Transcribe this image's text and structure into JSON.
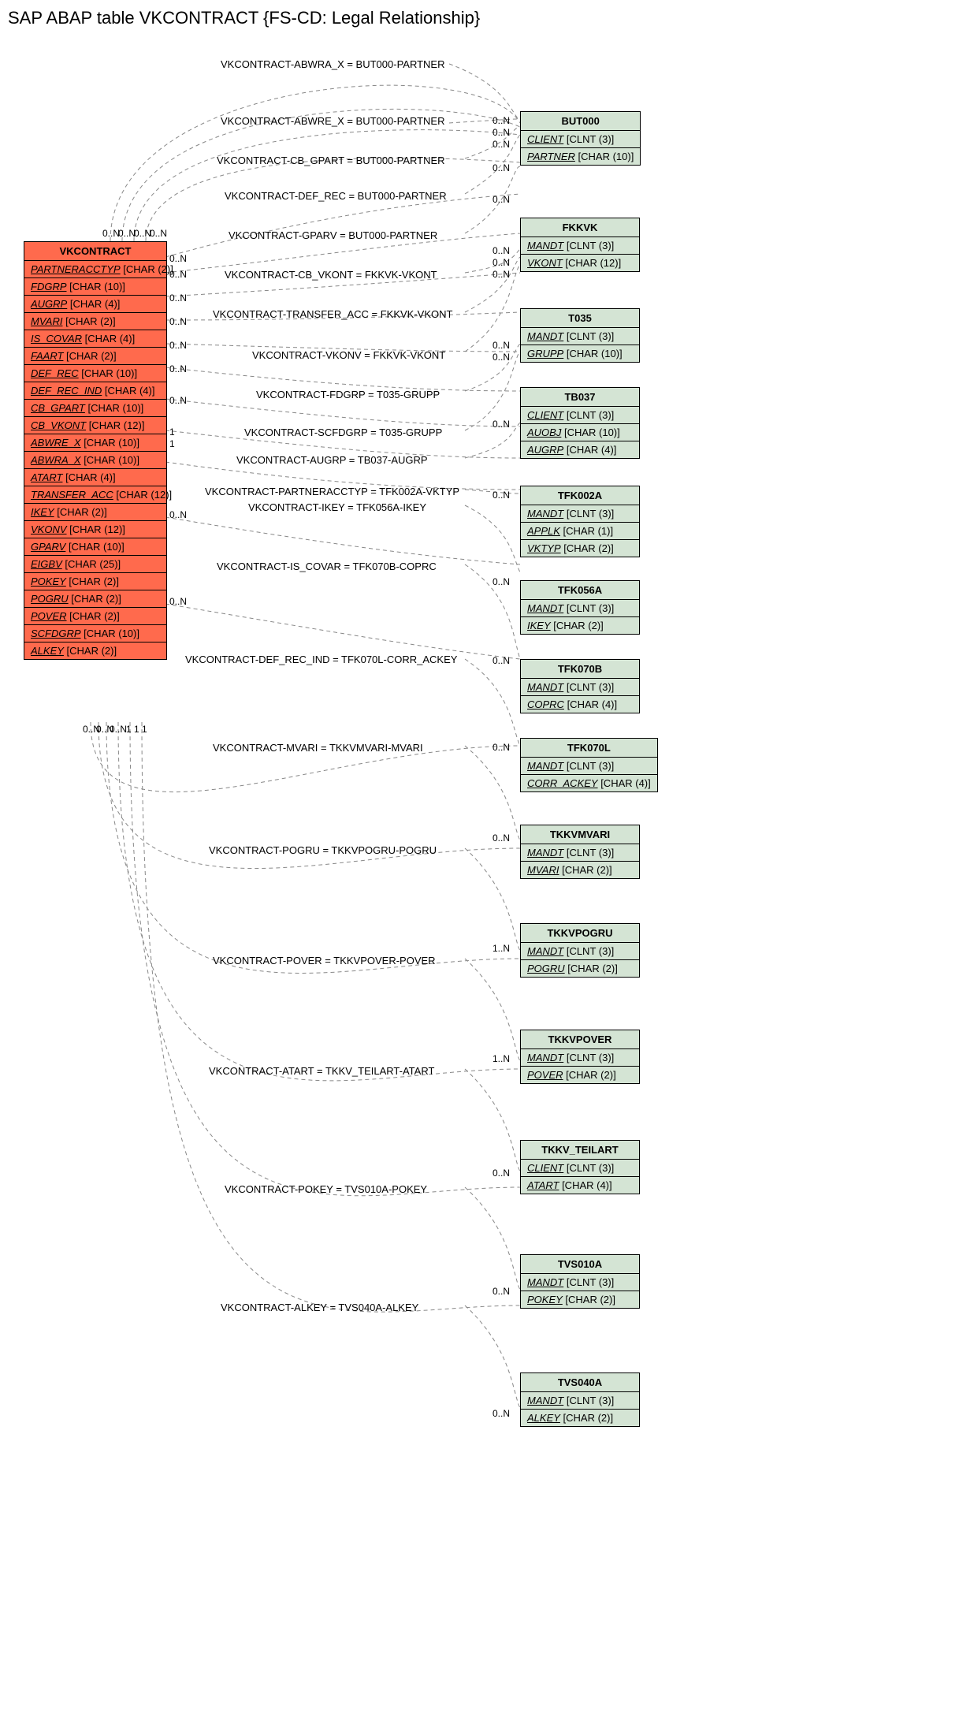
{
  "title": "SAP ABAP table VKCONTRACT {FS-CD: Legal Relationship}",
  "main_entity": {
    "name": "VKCONTRACT",
    "fields": [
      {
        "name": "PARTNERACCTYP",
        "type": "[CHAR (2)]"
      },
      {
        "name": "FDGRP",
        "type": "[CHAR (10)]"
      },
      {
        "name": "AUGRP",
        "type": "[CHAR (4)]"
      },
      {
        "name": "MVARI",
        "type": "[CHAR (2)]"
      },
      {
        "name": "IS_COVAR",
        "type": "[CHAR (4)]"
      },
      {
        "name": "FAART",
        "type": "[CHAR (2)]"
      },
      {
        "name": "DEF_REC",
        "type": "[CHAR (10)]"
      },
      {
        "name": "DEF_REC_IND",
        "type": "[CHAR (4)]"
      },
      {
        "name": "CB_GPART",
        "type": "[CHAR (10)]"
      },
      {
        "name": "CB_VKONT",
        "type": "[CHAR (12)]"
      },
      {
        "name": "ABWRE_X",
        "type": "[CHAR (10)]"
      },
      {
        "name": "ABWRA_X",
        "type": "[CHAR (10)]"
      },
      {
        "name": "ATART",
        "type": "[CHAR (4)]"
      },
      {
        "name": "TRANSFER_ACC",
        "type": "[CHAR (12)]"
      },
      {
        "name": "IKEY",
        "type": "[CHAR (2)]"
      },
      {
        "name": "VKONV",
        "type": "[CHAR (12)]"
      },
      {
        "name": "GPARV",
        "type": "[CHAR (10)]"
      },
      {
        "name": "EIGBV",
        "type": "[CHAR (25)]"
      },
      {
        "name": "POKEY",
        "type": "[CHAR (2)]"
      },
      {
        "name": "POGRU",
        "type": "[CHAR (2)]"
      },
      {
        "name": "POVER",
        "type": "[CHAR (2)]"
      },
      {
        "name": "SCFDGRP",
        "type": "[CHAR (10)]"
      },
      {
        "name": "ALKEY",
        "type": "[CHAR (2)]"
      }
    ]
  },
  "ref_entities": [
    {
      "name": "BUT000",
      "fields": [
        {
          "name": "CLIENT",
          "type": "[CLNT (3)]"
        },
        {
          "name": "PARTNER",
          "type": "[CHAR (10)]"
        }
      ]
    },
    {
      "name": "FKKVK",
      "fields": [
        {
          "name": "MANDT",
          "type": "[CLNT (3)]"
        },
        {
          "name": "VKONT",
          "type": "[CHAR (12)]"
        }
      ]
    },
    {
      "name": "T035",
      "fields": [
        {
          "name": "MANDT",
          "type": "[CLNT (3)]"
        },
        {
          "name": "GRUPP",
          "type": "[CHAR (10)]"
        }
      ]
    },
    {
      "name": "TB037",
      "fields": [
        {
          "name": "CLIENT",
          "type": "[CLNT (3)]"
        },
        {
          "name": "AUOBJ",
          "type": "[CHAR (10)]"
        },
        {
          "name": "AUGRP",
          "type": "[CHAR (4)]"
        }
      ]
    },
    {
      "name": "TFK002A",
      "fields": [
        {
          "name": "MANDT",
          "type": "[CLNT (3)]"
        },
        {
          "name": "APPLK",
          "type": "[CHAR (1)]"
        },
        {
          "name": "VKTYP",
          "type": "[CHAR (2)]"
        }
      ]
    },
    {
      "name": "TFK056A",
      "fields": [
        {
          "name": "MANDT",
          "type": "[CLNT (3)]"
        },
        {
          "name": "IKEY",
          "type": "[CHAR (2)]"
        }
      ]
    },
    {
      "name": "TFK070B",
      "fields": [
        {
          "name": "MANDT",
          "type": "[CLNT (3)]"
        },
        {
          "name": "COPRC",
          "type": "[CHAR (4)]"
        }
      ]
    },
    {
      "name": "TFK070L",
      "fields": [
        {
          "name": "MANDT",
          "type": "[CLNT (3)]"
        },
        {
          "name": "CORR_ACKEY",
          "type": "[CHAR (4)]"
        }
      ]
    },
    {
      "name": "TKKVMVARI",
      "fields": [
        {
          "name": "MANDT",
          "type": "[CLNT (3)]"
        },
        {
          "name": "MVARI",
          "type": "[CHAR (2)]"
        }
      ]
    },
    {
      "name": "TKKVPOGRU",
      "fields": [
        {
          "name": "MANDT",
          "type": "[CLNT (3)]"
        },
        {
          "name": "POGRU",
          "type": "[CHAR (2)]"
        }
      ]
    },
    {
      "name": "TKKVPOVER",
      "fields": [
        {
          "name": "MANDT",
          "type": "[CLNT (3)]"
        },
        {
          "name": "POVER",
          "type": "[CHAR (2)]"
        }
      ]
    },
    {
      "name": "TKKV_TEILART",
      "fields": [
        {
          "name": "CLIENT",
          "type": "[CLNT (3)]"
        },
        {
          "name": "ATART",
          "type": "[CHAR (4)]"
        }
      ]
    },
    {
      "name": "TVS010A",
      "fields": [
        {
          "name": "MANDT",
          "type": "[CLNT (3)]"
        },
        {
          "name": "POKEY",
          "type": "[CHAR (2)]"
        }
      ]
    },
    {
      "name": "TVS040A",
      "fields": [
        {
          "name": "MANDT",
          "type": "[CLNT (3)]"
        },
        {
          "name": "ALKEY",
          "type": "[CHAR (2)]"
        }
      ]
    }
  ],
  "relations": [
    {
      "text": "VKCONTRACT-ABWRA_X = BUT000-PARTNER",
      "lc": "0..N",
      "rc": "0..N"
    },
    {
      "text": "VKCONTRACT-ABWRE_X = BUT000-PARTNER",
      "lc": "0..N",
      "rc": "0..N"
    },
    {
      "text": "VKCONTRACT-CB_GPART = BUT000-PARTNER",
      "lc": "0..N",
      "rc": "0..N"
    },
    {
      "text": "VKCONTRACT-DEF_REC = BUT000-PARTNER",
      "lc": "0..N",
      "rc": "0..N"
    },
    {
      "text": "VKCONTRACT-GPARV = BUT000-PARTNER",
      "lc": "0..N",
      "rc": "0..N"
    },
    {
      "text": "VKCONTRACT-CB_VKONT = FKKVK-VKONT",
      "lc": "0..N",
      "rc": "0..N"
    },
    {
      "text": "VKCONTRACT-TRANSFER_ACC = FKKVK-VKONT",
      "lc": "0..N",
      "rc": "0..N"
    },
    {
      "text": "VKCONTRACT-VKONV = FKKVK-VKONT",
      "lc": "0..N",
      "rc": "0..N"
    },
    {
      "text": "VKCONTRACT-FDGRP = T035-GRUPP",
      "lc": "0..N",
      "rc": "0..N"
    },
    {
      "text": "VKCONTRACT-SCFDGRP = T035-GRUPP",
      "lc": "0..N",
      "rc": "0..N"
    },
    {
      "text": "VKCONTRACT-AUGRP = TB037-AUGRP",
      "lc": "0..N",
      "rc": "0..N"
    },
    {
      "text": "VKCONTRACT-PARTNERACCTYP = TFK002A-VKTYP",
      "lc": "1",
      "rc": "0..N"
    },
    {
      "text": "VKCONTRACT-IKEY = TFK056A-IKEY",
      "lc": "1",
      "rc": "0..N"
    },
    {
      "text": "VKCONTRACT-IS_COVAR = TFK070B-COPRC",
      "lc": "0..N",
      "rc": "0..N"
    },
    {
      "text": "VKCONTRACT-DEF_REC_IND = TFK070L-CORR_ACKEY",
      "lc": "0..N",
      "rc": "0..N"
    },
    {
      "text": "VKCONTRACT-MVARI = TKKVMVARI-MVARI",
      "lc": "0..N",
      "rc": "0..N"
    },
    {
      "text": "VKCONTRACT-POGRU = TKKVPOGRU-POGRU",
      "lc": "0..N",
      "rc": "1..N"
    },
    {
      "text": "VKCONTRACT-POVER = TKKVPOVER-POVER",
      "lc": "0..N",
      "rc": "1..N"
    },
    {
      "text": "VKCONTRACT-ATART = TKKV_TEILART-ATART",
      "lc": "1",
      "rc": "0..N"
    },
    {
      "text": "VKCONTRACT-POKEY = TVS010A-POKEY",
      "lc": "1",
      "rc": "0..N"
    },
    {
      "text": "VKCONTRACT-ALKEY = TVS040A-ALKEY",
      "lc": "1",
      "rc": "0..N"
    }
  ],
  "left_top_cards": [
    "0..N",
    "0..N",
    "0..N",
    "0..N"
  ],
  "left_bottom_cards": [
    "0..N",
    "0..N",
    "0..N",
    "1",
    "1",
    "1"
  ],
  "right_side_cards": [
    "0..N",
    "0..N",
    "0..N",
    "0..N",
    "0..N",
    "0..N",
    "0..N",
    "0..N",
    "1",
    "1",
    "1",
    "0..N",
    "0..N"
  ]
}
